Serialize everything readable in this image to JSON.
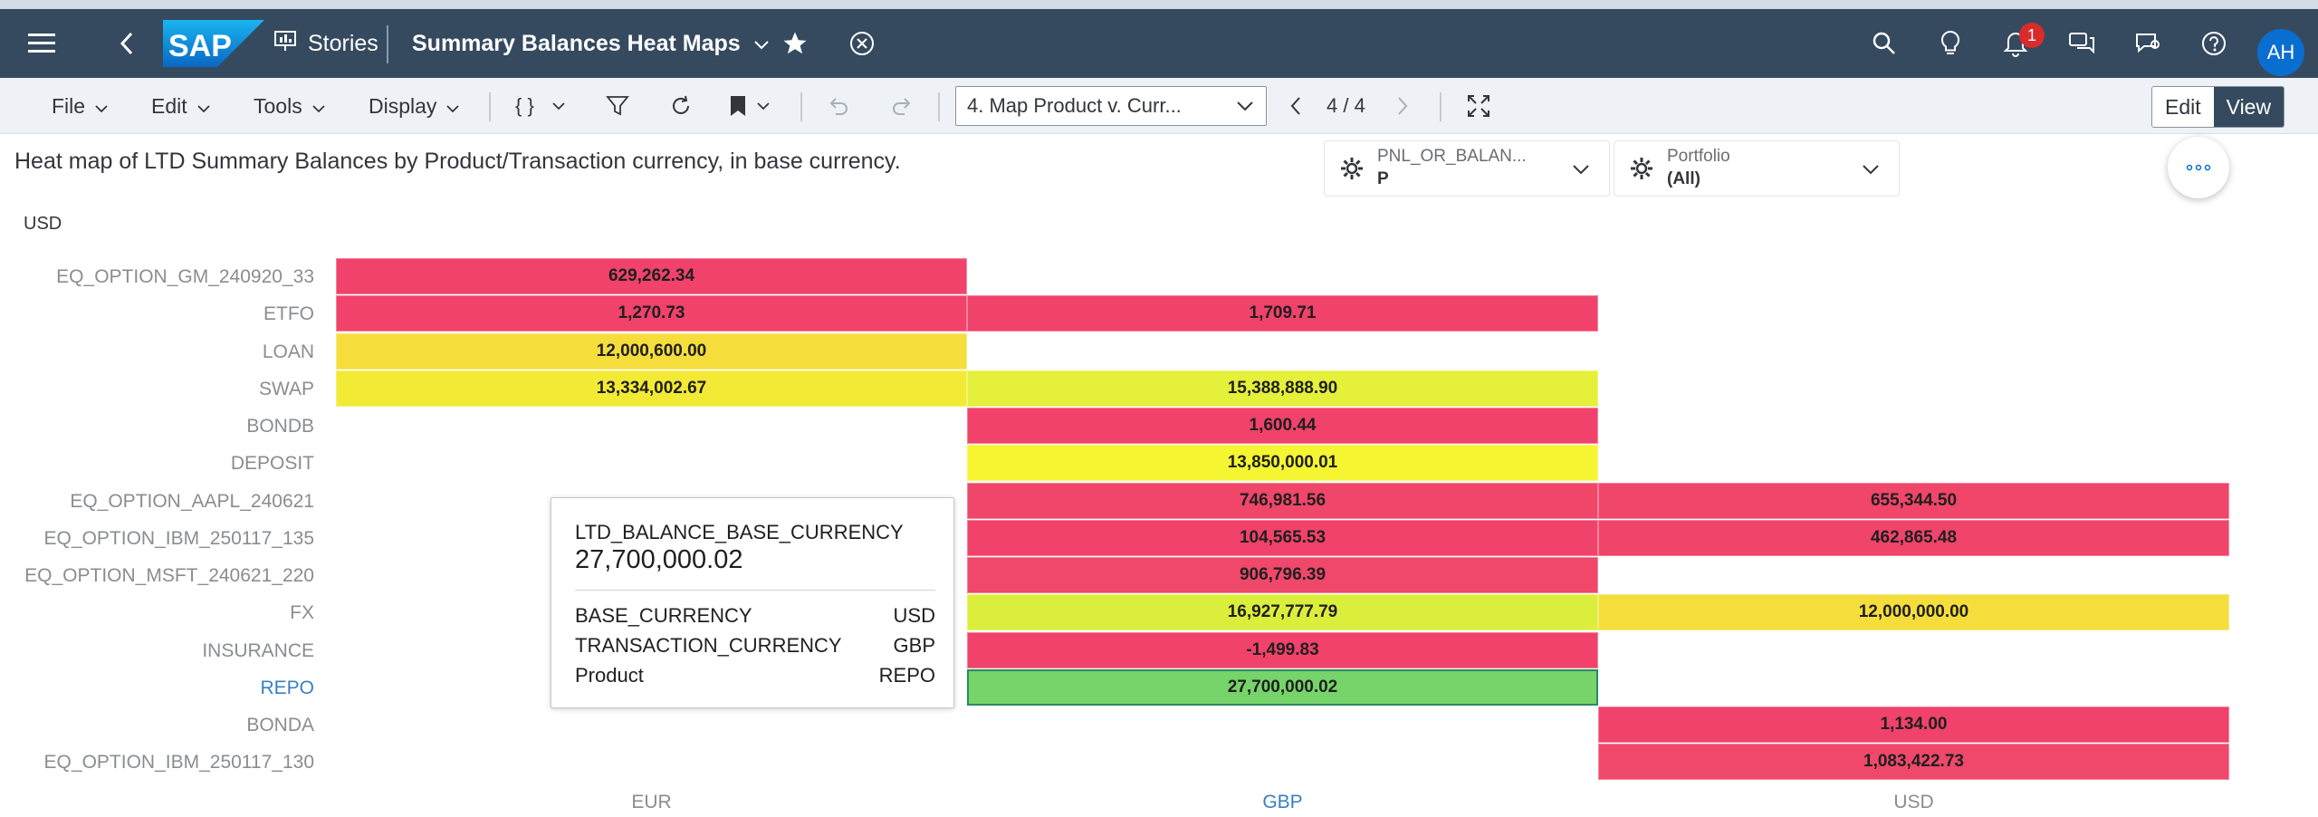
{
  "shell": {
    "logo_text": "SAP",
    "stories_label": "Stories",
    "story_title": "Summary Balances Heat Maps",
    "notification_count": "1",
    "avatar_initials": "AH"
  },
  "toolbar": {
    "menus": [
      "File",
      "Edit",
      "Tools",
      "Display"
    ],
    "page_select": "4. Map Product v. Curr...",
    "page_count": "4 / 4",
    "mode_edit": "Edit",
    "mode_view": "View"
  },
  "description": "Heat map of LTD Summary Balances by Product/Transaction currency, in base currency.",
  "filters": [
    {
      "label": "PNL_OR_BALAN...",
      "value": "P"
    },
    {
      "label": "Portfolio",
      "value": "(All)"
    }
  ],
  "unit_label": "USD",
  "heatmap": {
    "rows": [
      "EQ_OPTION_GM_240920_33",
      "ETFO",
      "LOAN",
      "SWAP",
      "BONDB",
      "DEPOSIT",
      "EQ_OPTION_AAPL_240621",
      "EQ_OPTION_IBM_250117_135",
      "EQ_OPTION_MSFT_240621_220",
      "FX",
      "INSURANCE",
      "REPO",
      "BONDA",
      "EQ_OPTION_IBM_250117_130"
    ],
    "columns": [
      "EUR",
      "GBP",
      "USD"
    ],
    "highlight_row": "REPO",
    "highlight_column": "GBP",
    "cells": [
      {
        "row": "EQ_OPTION_GM_240920_33",
        "col": "EUR",
        "text": "629,262.34",
        "value": 629262.34,
        "color": "#f0426a"
      },
      {
        "row": "ETFO",
        "col": "EUR",
        "text": "1,270.73",
        "value": 1270.73,
        "color": "#f0426a"
      },
      {
        "row": "ETFO",
        "col": "GBP",
        "text": "1,709.71",
        "value": 1709.71,
        "color": "#f0426a"
      },
      {
        "row": "LOAN",
        "col": "EUR",
        "text": "12,000,600.00",
        "value": 12000600.0,
        "color": "#f5de3c"
      },
      {
        "row": "SWAP",
        "col": "EUR",
        "text": "13,334,002.67",
        "value": 13334002.67,
        "color": "#f3ea36"
      },
      {
        "row": "SWAP",
        "col": "GBP",
        "text": "15,388,888.90",
        "value": 15388888.9,
        "color": "#e4f03a"
      },
      {
        "row": "BONDB",
        "col": "GBP",
        "text": "1,600.44",
        "value": 1600.44,
        "color": "#f0426a"
      },
      {
        "row": "DEPOSIT",
        "col": "GBP",
        "text": "13,850,000.01",
        "value": 13850000.01,
        "color": "#f5f532"
      },
      {
        "row": "EQ_OPTION_AAPL_240621",
        "col": "GBP",
        "text": "746,981.56",
        "value": 746981.56,
        "color": "#f0466a"
      },
      {
        "row": "EQ_OPTION_AAPL_240621",
        "col": "USD",
        "text": "655,344.50",
        "value": 655344.5,
        "color": "#f0466a"
      },
      {
        "row": "EQ_OPTION_IBM_250117_135",
        "col": "GBP",
        "text": "104,565.53",
        "value": 104565.53,
        "color": "#f0426a"
      },
      {
        "row": "EQ_OPTION_IBM_250117_135",
        "col": "USD",
        "text": "462,865.48",
        "value": 462865.48,
        "color": "#f0446a"
      },
      {
        "row": "EQ_OPTION_MSFT_240621_220",
        "col": "GBP",
        "text": "906,796.39",
        "value": 906796.39,
        "color": "#f0486a"
      },
      {
        "row": "FX",
        "col": "GBP",
        "text": "16,927,777.79",
        "value": 16927777.79,
        "color": "#dcee3c"
      },
      {
        "row": "FX",
        "col": "USD",
        "text": "12,000,000.00",
        "value": 12000000.0,
        "color": "#f5de3c"
      },
      {
        "row": "INSURANCE",
        "col": "GBP",
        "text": "-1,499.83",
        "value": -1499.83,
        "color": "#f0426a"
      },
      {
        "row": "REPO",
        "col": "GBP",
        "text": "27,700,000.02",
        "value": 27700000.02,
        "color": "#76d46a",
        "selected": true
      },
      {
        "row": "BONDA",
        "col": "USD",
        "text": "1,134.00",
        "value": 1134.0,
        "color": "#f0426a"
      },
      {
        "row": "EQ_OPTION_IBM_250117_130",
        "col": "USD",
        "text": "1,083,422.73",
        "value": 1083422.73,
        "color": "#f0486a"
      }
    ]
  },
  "tooltip": {
    "measure": "LTD_BALANCE_BASE_CURRENCY",
    "value": "27,700,000.02",
    "rows": [
      {
        "key": "BASE_CURRENCY",
        "val": "USD"
      },
      {
        "key": "TRANSACTION_CURRENCY",
        "val": "GBP"
      },
      {
        "key": "Product",
        "val": "REPO"
      }
    ]
  },
  "icons": [
    "menu-icon",
    "back-icon",
    "stories-icon",
    "chevron-down-icon",
    "star-icon",
    "close-circle-icon",
    "search-icon",
    "lightbulb-icon",
    "bell-icon",
    "chat-icon",
    "feedback-icon",
    "help-icon",
    "code-braces-icon",
    "filter-icon",
    "refresh-icon",
    "bookmark-icon",
    "undo-icon",
    "redo-icon",
    "prev-page-icon",
    "next-page-icon",
    "fullscreen-icon",
    "dimension-icon",
    "more-icon"
  ]
}
